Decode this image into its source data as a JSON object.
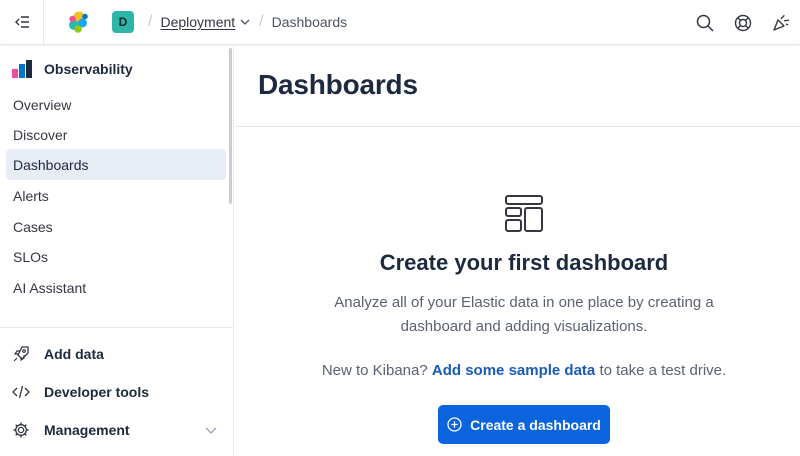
{
  "header": {
    "space_initial": "D",
    "breadcrumb": {
      "deployment": "Deployment",
      "current": "Dashboards"
    }
  },
  "sidebar": {
    "title": "Observability",
    "items": [
      {
        "label": "Overview"
      },
      {
        "label": "Discover"
      },
      {
        "label": "Dashboards"
      },
      {
        "label": "Alerts"
      },
      {
        "label": "Cases"
      },
      {
        "label": "SLOs"
      },
      {
        "label": "AI Assistant"
      }
    ],
    "bottom": [
      {
        "label": "Add data",
        "icon": "rocket-icon"
      },
      {
        "label": "Developer tools",
        "icon": "code-icon"
      },
      {
        "label": "Management",
        "icon": "gear-icon"
      }
    ]
  },
  "main": {
    "title": "Dashboards",
    "empty": {
      "title": "Create your first dashboard",
      "description": "Analyze all of your Elastic data in one place by creating a dashboard and adding visualizations.",
      "sample_prefix": "New to Kibana?",
      "sample_link": "Add some sample data",
      "sample_suffix": "to take a test drive.",
      "button": "Create a dashboard"
    }
  },
  "colors": {
    "primary": "#0b64dd",
    "link": "#1a5bb8",
    "active_bg": "#e7ecf5",
    "space_avatar": "#2fb5a8"
  }
}
